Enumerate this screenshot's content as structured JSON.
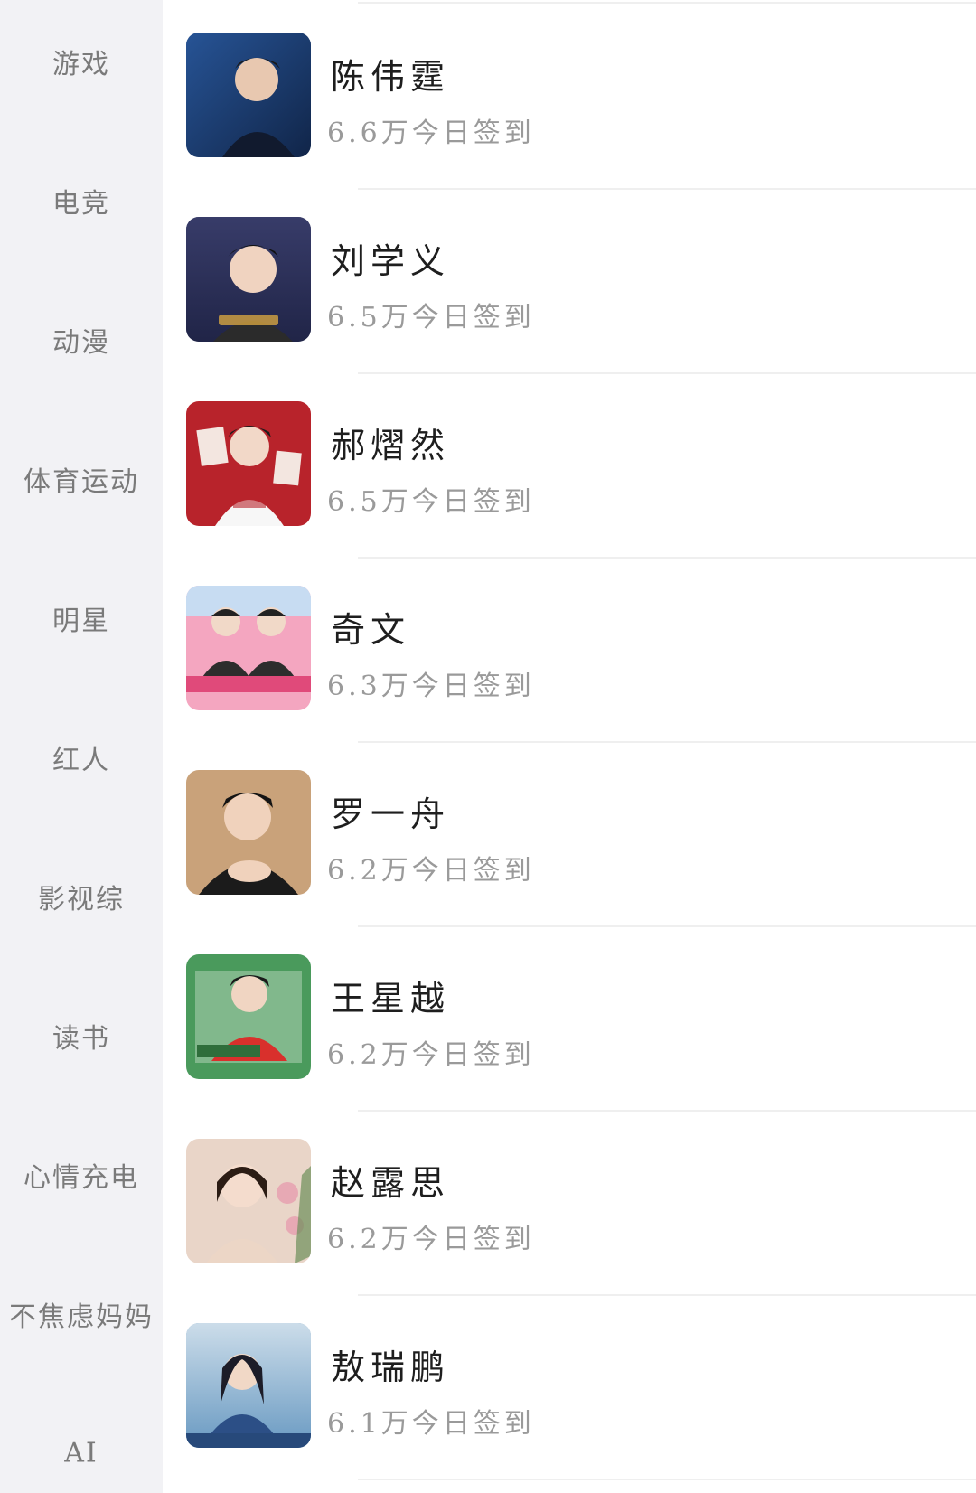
{
  "sidebar": {
    "categories": [
      {
        "label": "游戏"
      },
      {
        "label": "电竞"
      },
      {
        "label": "动漫"
      },
      {
        "label": "体育运动"
      },
      {
        "label": "明星"
      },
      {
        "label": "红人"
      },
      {
        "label": "影视综"
      },
      {
        "label": "读书"
      },
      {
        "label": "心情充电"
      },
      {
        "label": "不焦虑妈妈"
      },
      {
        "label": "AI"
      }
    ]
  },
  "list": {
    "items": [
      {
        "name": "陈伟霆",
        "checkins": "6.6万今日签到",
        "avatar_color": "#1b3a6b"
      },
      {
        "name": "刘学义",
        "checkins": "6.5万今日签到",
        "avatar_color": "#2a2f55"
      },
      {
        "name": "郝熠然",
        "checkins": "6.5万今日签到",
        "avatar_color": "#b8232b"
      },
      {
        "name": "奇文",
        "checkins": "6.3万今日签到",
        "avatar_color": "#f4a6c0"
      },
      {
        "name": "罗一舟",
        "checkins": "6.2万今日签到",
        "avatar_color": "#c9a27a"
      },
      {
        "name": "王星越",
        "checkins": "6.2万今日签到",
        "avatar_color": "#4a9a5c"
      },
      {
        "name": "赵露思",
        "checkins": "6.2万今日签到",
        "avatar_color": "#e9d5c8"
      },
      {
        "name": "敖瑞鹏",
        "checkins": "6.1万今日签到",
        "avatar_color": "#5b8fb8"
      }
    ]
  }
}
